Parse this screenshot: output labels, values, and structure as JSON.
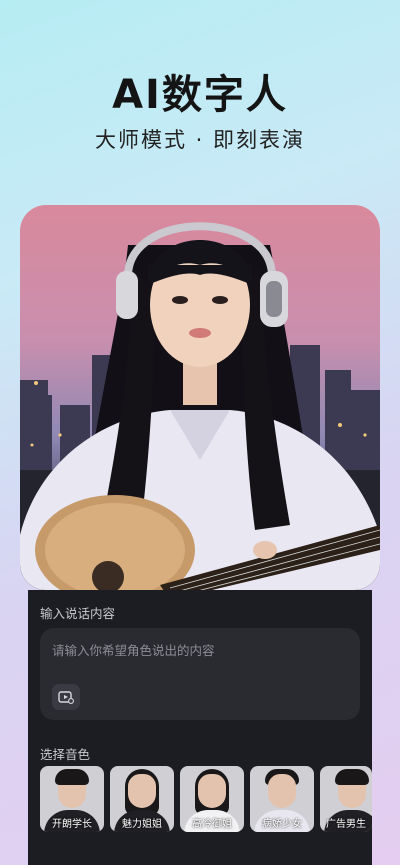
{
  "hero": {
    "title": "AI数字人",
    "subtitle": "大师模式 · 即刻表演"
  },
  "speech_input": {
    "label": "输入说话内容",
    "placeholder": "请输入你希望角色说出的内容",
    "media_icon": "video-upload-icon"
  },
  "voice_select": {
    "label": "选择音色",
    "voices": [
      {
        "name": "开朗学长"
      },
      {
        "name": "魅力姐姐"
      },
      {
        "name": "高冷御姐"
      },
      {
        "name": "病娇少女"
      },
      {
        "name": "广告男生"
      }
    ]
  },
  "colors": {
    "panel_bg": "#1c1d22",
    "input_bg": "#2a2b31",
    "title_color": "#141414"
  }
}
